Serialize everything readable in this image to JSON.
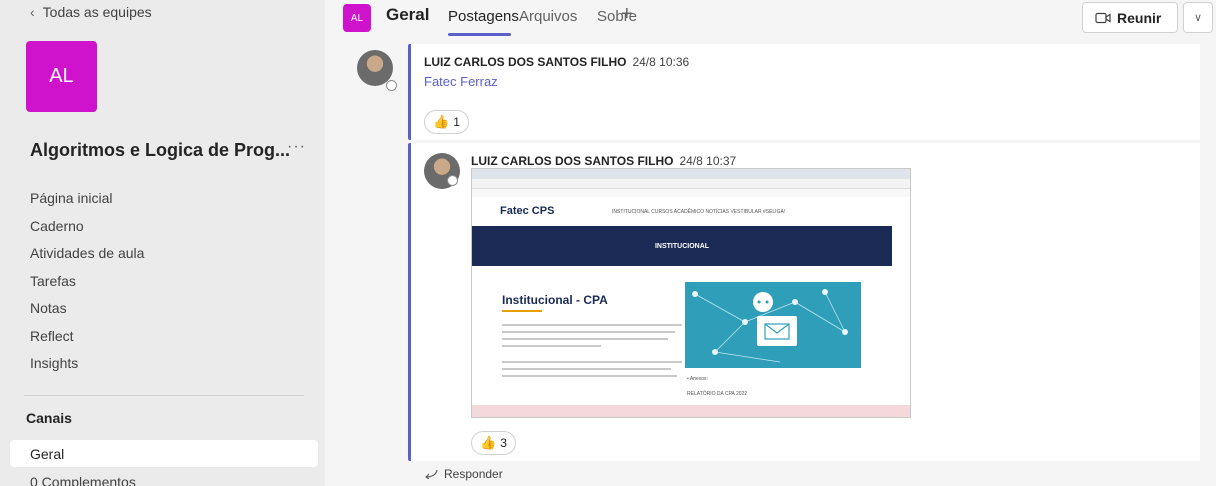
{
  "sidebar": {
    "back_label": "Todas as equipes",
    "team_initials": "AL",
    "team_name": "Algoritmos e Logica de Prog...",
    "more": "···",
    "nav": [
      "Página inicial",
      "Caderno",
      "Atividades de aula",
      "Tarefas",
      "Notas",
      "Reflect",
      "Insights"
    ],
    "channels_label": "Canais",
    "channels": [
      "Geral",
      "0 Complementos"
    ]
  },
  "header": {
    "channel_initials": "AL",
    "channel_title": "Geral",
    "tabs": [
      "Postagens",
      "Arquivos",
      "Sobre"
    ],
    "add": "+",
    "meet_label": "Reunir"
  },
  "posts": [
    {
      "author": "LUIZ CARLOS DOS SANTOS FILHO",
      "timestamp": "24/8 10:36",
      "text": "Fatec Ferraz",
      "reaction_emoji": "👍",
      "reaction_count": "1"
    },
    {
      "author": "LUIZ CARLOS DOS SANTOS FILHO",
      "timestamp": "24/8 10:37",
      "reaction_emoji": "👍",
      "reaction_count": "3",
      "screenshot": {
        "logo": "Fatec CPS",
        "nav": "INSTITUCIONAL   CURSOS   ACADÊMICO   NOTÍCIAS   VESTIBULAR   #SELIGA!",
        "banner": "INSTITUCIONAL",
        "heading": "Institucional - CPA",
        "annex": "• Anexos:",
        "report": "RELATÓRIO DA CPA 2022"
      }
    }
  ],
  "reply_label": "Responder",
  "colors": {
    "accent": "#5b5fc7",
    "team": "#cf13cc"
  }
}
